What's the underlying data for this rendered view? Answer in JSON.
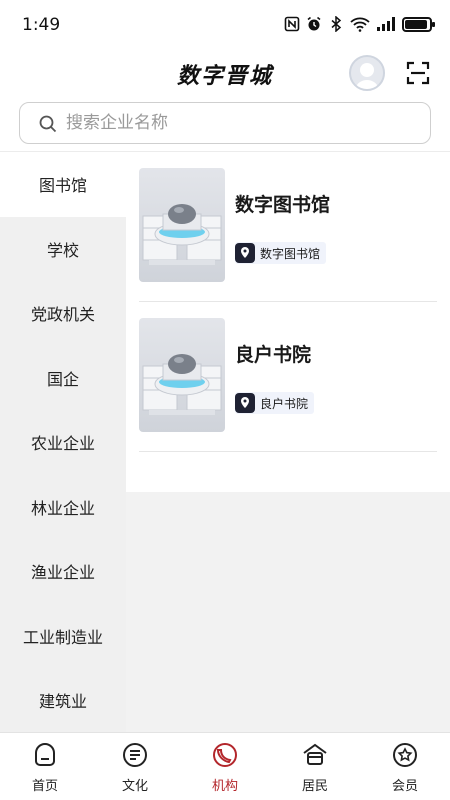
{
  "status": {
    "time": "1:49",
    "battery_level": 0.9
  },
  "header": {
    "title": "数字晋城"
  },
  "search": {
    "placeholder": "搜索企业名称",
    "value": ""
  },
  "sidebar": {
    "items": [
      {
        "label": "图书馆",
        "active": true
      },
      {
        "label": "学校"
      },
      {
        "label": "党政机关"
      },
      {
        "label": "国企"
      },
      {
        "label": "农业企业"
      },
      {
        "label": "林业企业"
      },
      {
        "label": "渔业企业"
      },
      {
        "label": "工业制造业"
      },
      {
        "label": "建筑业"
      }
    ]
  },
  "cards": [
    {
      "name": "数字图书馆",
      "tag": "数字图书馆"
    },
    {
      "name": "良户书院",
      "tag": "良户书院"
    }
  ],
  "tabbar": {
    "items": [
      {
        "label": "首页",
        "icon": "home-icon"
      },
      {
        "label": "文化",
        "icon": "culture-icon"
      },
      {
        "label": "机构",
        "icon": "institution-icon",
        "active": true
      },
      {
        "label": "居民",
        "icon": "resident-icon"
      },
      {
        "label": "会员",
        "icon": "member-icon"
      }
    ]
  },
  "colors": {
    "accent": "#b3262b",
    "sidebar_bg": "#f0f0f0",
    "tag_bg": "#f0f3fb",
    "pin": "#1f2233"
  }
}
